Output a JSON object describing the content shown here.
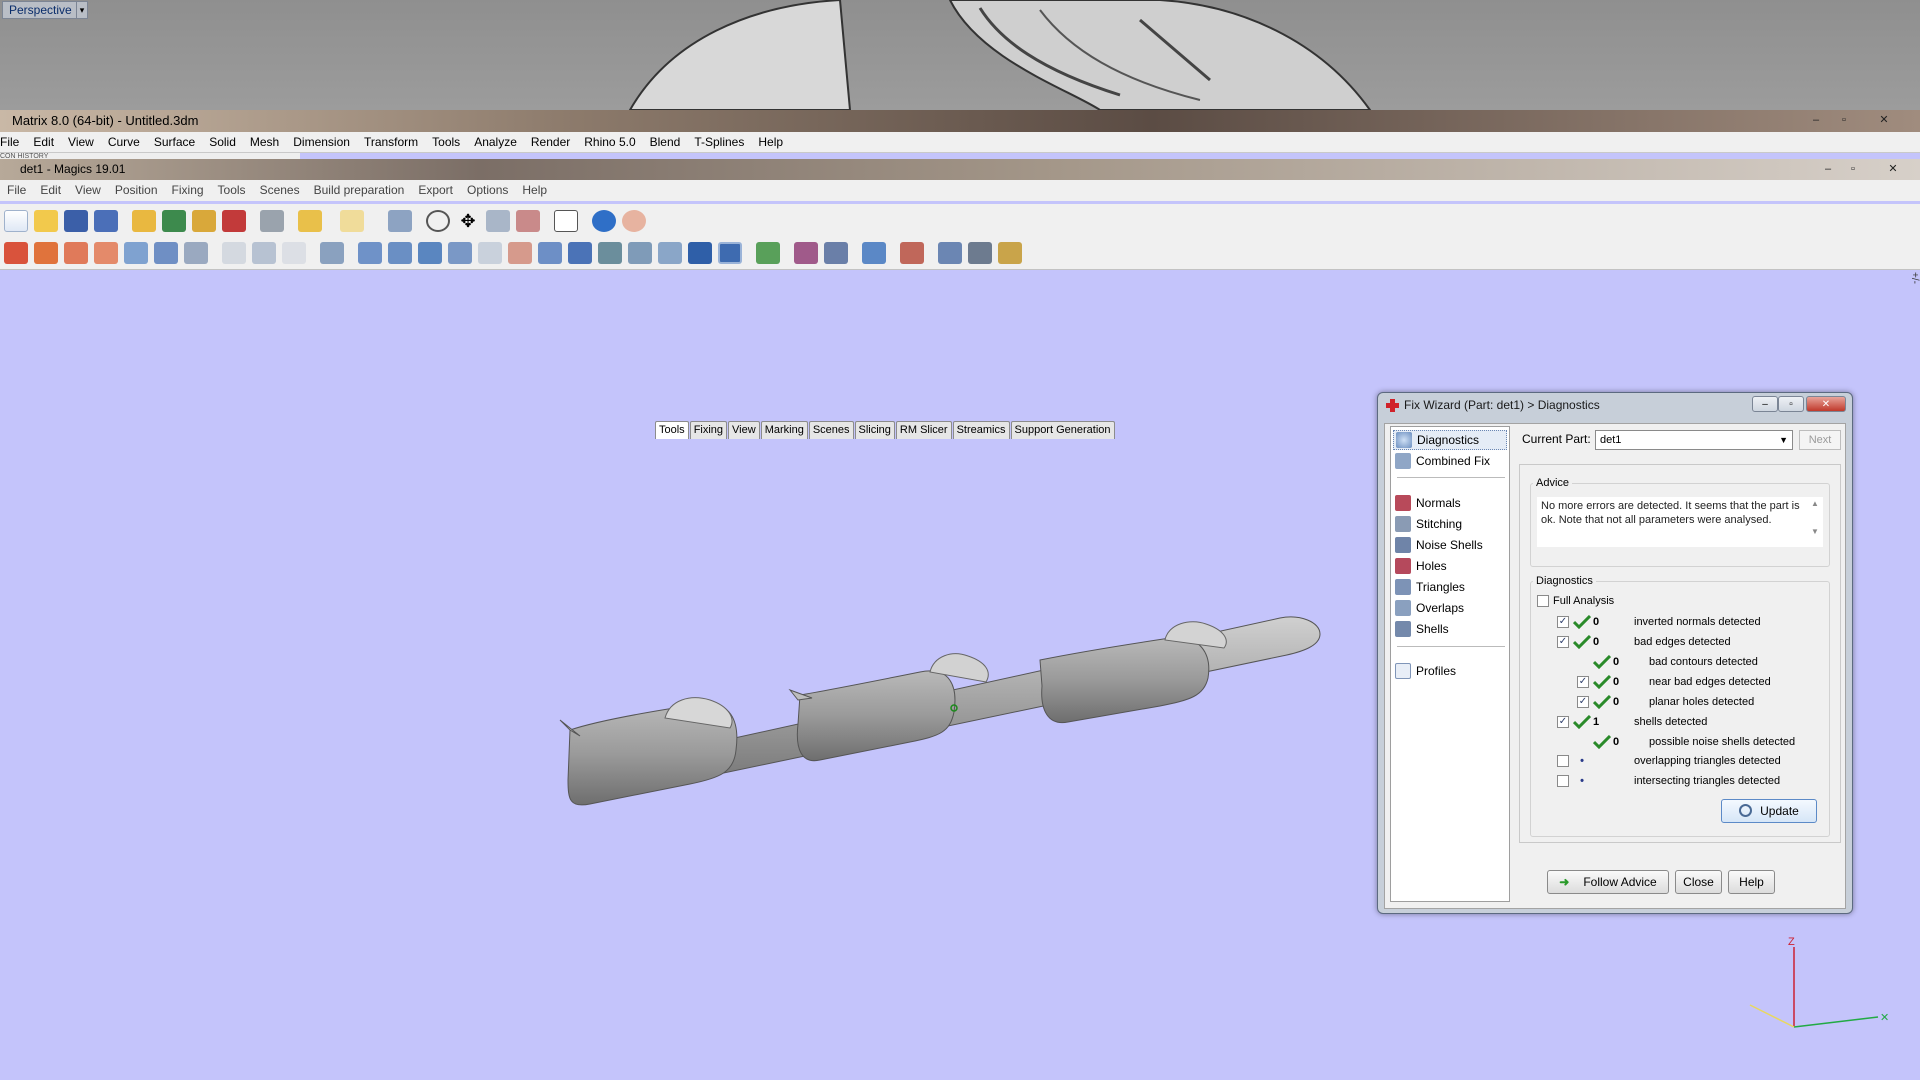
{
  "rhino": {
    "viewport_label": "Perspective",
    "viewport_arrow": "▾",
    "title": "Matrix 8.0 (64-bit) - Untitled.3dm",
    "window_buttons": [
      "–",
      "▫",
      "✕"
    ],
    "menu": [
      "File",
      "Edit",
      "View",
      "Curve",
      "Surface",
      "Solid",
      "Mesh",
      "Dimension",
      "Transform",
      "Tools",
      "Analyze",
      "Render",
      "Rhino 5.0",
      "Blend",
      "T-Splines",
      "Help"
    ],
    "history_fragment": "CON HISTORY"
  },
  "magics": {
    "title": "det1 - Magics 19.01",
    "window_buttons": [
      "–",
      "▫",
      "✕"
    ],
    "menu": [
      "File",
      "Edit",
      "View",
      "Position",
      "Fixing",
      "Tools",
      "Scenes",
      "Build preparation",
      "Export",
      "Options",
      "Help"
    ],
    "tabs": [
      "Tools",
      "Fixing",
      "View",
      "Marking",
      "Scenes",
      "Slicing",
      "RM Slicer",
      "Streamics",
      "Support Generation"
    ],
    "active_tab": "Tools",
    "side_splitter": "+/-"
  },
  "fix_wizard": {
    "title": "Fix Wizard (Part: det1) > Diagnostics",
    "window_buttons": [
      "–",
      "▫",
      "✕"
    ],
    "sidebar": {
      "top": [
        "Diagnostics",
        "Combined Fix"
      ],
      "tools": [
        "Normals",
        "Stitching",
        "Noise Shells",
        "Holes",
        "Triangles",
        "Overlaps",
        "Shells"
      ],
      "bottom": [
        "Profiles"
      ]
    },
    "current_part_label": "Current Part:",
    "current_part_value": "det1",
    "next_label": "Next",
    "advice_label": "Advice",
    "advice_text": "No more errors are detected. It seems that the part is ok. Note that not all parameters were analysed.",
    "diagnostics_label": "Diagnostics",
    "full_analysis_label": "Full Analysis",
    "rows": [
      {
        "checked": true,
        "status": "ok",
        "count": "0",
        "label": "inverted normals detected",
        "indent": 0
      },
      {
        "checked": true,
        "status": "ok",
        "count": "0",
        "label": "bad edges detected",
        "indent": 0
      },
      {
        "checked": null,
        "status": "ok",
        "count": "0",
        "label": "bad contours detected",
        "indent": 1
      },
      {
        "checked": true,
        "status": "ok",
        "count": "0",
        "label": "near bad edges detected",
        "indent": 1
      },
      {
        "checked": true,
        "status": "ok",
        "count": "0",
        "label": "planar holes detected",
        "indent": 1
      },
      {
        "checked": true,
        "status": "ok",
        "count": "1",
        "label": "shells detected",
        "indent": 0
      },
      {
        "checked": null,
        "status": "ok",
        "count": "0",
        "label": "possible noise shells detected",
        "indent": 1
      },
      {
        "checked": false,
        "status": "pending",
        "count": "",
        "label": "overlapping triangles detected",
        "indent": 0
      },
      {
        "checked": false,
        "status": "pending",
        "count": "",
        "label": "intersecting triangles detected",
        "indent": 0
      }
    ],
    "update_label": "Update",
    "follow_advice_label": "Follow Advice",
    "close_label": "Close",
    "help_label": "Help"
  },
  "axis": {
    "z_label": "Z"
  },
  "colors": {
    "viewport_bg": "#c4c4fb",
    "check_green": "#2a8a2a",
    "dialog_frame": "#c7cfd9"
  }
}
